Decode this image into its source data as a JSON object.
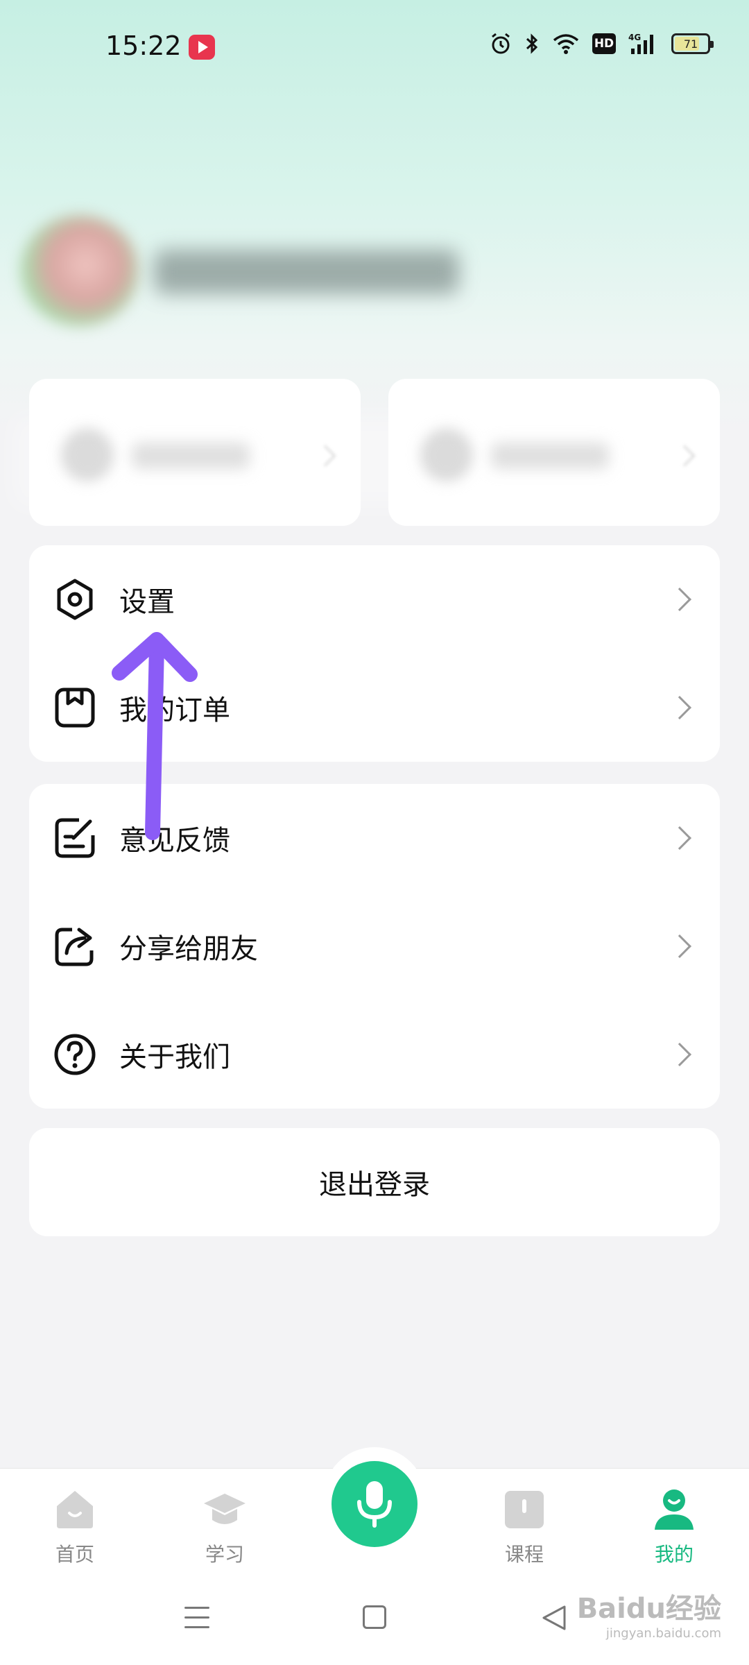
{
  "status_bar": {
    "time": "15:22",
    "hd": "HD",
    "battery": "71",
    "network": "4G"
  },
  "menu_group_1": [
    {
      "label": "设置",
      "icon": "settings-icon"
    },
    {
      "label": "我的订单",
      "icon": "order-icon"
    }
  ],
  "menu_group_2": [
    {
      "label": "意见反馈",
      "icon": "feedback-icon"
    },
    {
      "label": "分享给朋友",
      "icon": "share-icon"
    },
    {
      "label": "关于我们",
      "icon": "help-icon"
    }
  ],
  "logout_label": "退出登录",
  "bottom_nav": [
    {
      "label": "首页",
      "icon": "home-icon"
    },
    {
      "label": "学习",
      "icon": "graduation-cap-icon"
    },
    {
      "label": "",
      "icon": "microphone-icon"
    },
    {
      "label": "课程",
      "icon": "book-icon"
    },
    {
      "label": "我的",
      "icon": "profile-icon",
      "active": true
    }
  ],
  "watermark": {
    "brand": "Baidu经验",
    "url": "jingyan.baidu.com"
  },
  "colors": {
    "accent": "#18b981",
    "mic": "#20c98e",
    "annotation_arrow": "#8b5cf6"
  }
}
